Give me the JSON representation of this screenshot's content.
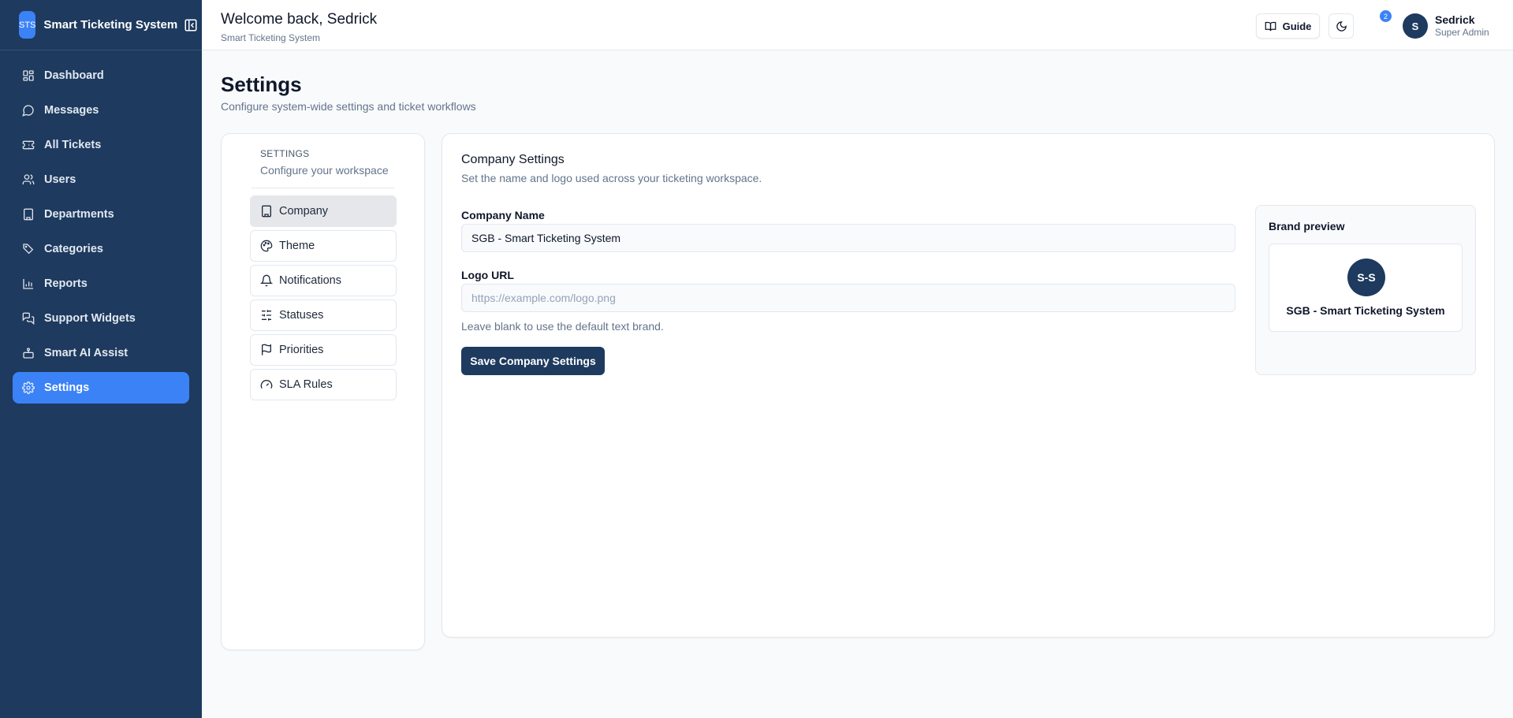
{
  "sidebar": {
    "logo_text": "STS",
    "app_name": "Smart Ticketing System",
    "items": [
      {
        "label": "Dashboard",
        "icon": "dashboard-icon"
      },
      {
        "label": "Messages",
        "icon": "message-icon"
      },
      {
        "label": "All Tickets",
        "icon": "ticket-icon"
      },
      {
        "label": "Users",
        "icon": "users-icon"
      },
      {
        "label": "Departments",
        "icon": "building-icon"
      },
      {
        "label": "Categories",
        "icon": "tags-icon"
      },
      {
        "label": "Reports",
        "icon": "bar-chart-icon"
      },
      {
        "label": "Support Widgets",
        "icon": "chat-widget-icon"
      },
      {
        "label": "Smart AI Assist",
        "icon": "bot-icon"
      },
      {
        "label": "Settings",
        "icon": "gear-icon",
        "active": true
      }
    ]
  },
  "header": {
    "welcome": "Welcome back, Sedrick",
    "subtitle": "Smart Ticketing System",
    "guide_label": "Guide",
    "notification_count": "2",
    "user": {
      "initial": "S",
      "name": "Sedrick",
      "role": "Super Admin"
    }
  },
  "page": {
    "title": "Settings",
    "subtitle": "Configure system-wide settings and ticket workflows"
  },
  "settings_nav": {
    "heading": "SETTINGS",
    "subheading": "Configure your workspace",
    "items": [
      {
        "label": "Company",
        "icon": "building-icon",
        "active": true
      },
      {
        "label": "Theme",
        "icon": "palette-icon"
      },
      {
        "label": "Notifications",
        "icon": "bell-icon"
      },
      {
        "label": "Statuses",
        "icon": "sliders-icon"
      },
      {
        "label": "Priorities",
        "icon": "flag-icon"
      },
      {
        "label": "SLA Rules",
        "icon": "gauge-icon"
      }
    ]
  },
  "company": {
    "title": "Company Settings",
    "subtitle": "Set the name and logo used across your ticketing workspace.",
    "name_label": "Company Name",
    "name_value": "SGB - Smart Ticketing System",
    "logo_label": "Logo URL",
    "logo_value": "",
    "logo_placeholder": "https://example.com/logo.png",
    "logo_hint": "Leave blank to use the default text brand.",
    "save_label": "Save Company Settings",
    "preview": {
      "title": "Brand preview",
      "logo_text": "S-S",
      "name": "SGB - Smart Ticketing System"
    }
  },
  "colors": {
    "sidebar_bg": "#1e3a5f",
    "accent": "#3b82f6",
    "primary_button": "#1e3a5f",
    "page_bg": "#f8fafc"
  }
}
